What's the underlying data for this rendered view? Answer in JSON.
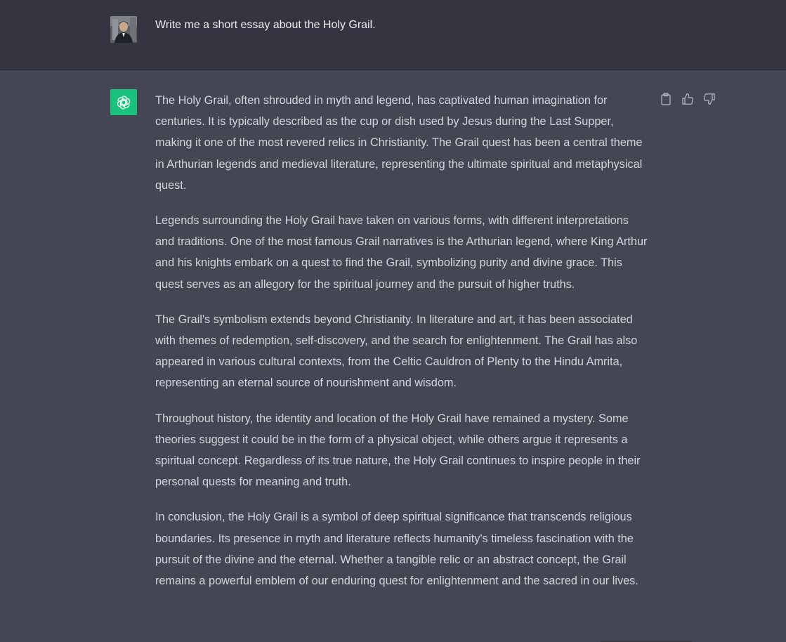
{
  "conversation": {
    "user_message": "Write me a short essay about the Holy Grail.",
    "assistant_paragraphs": [
      "The Holy Grail, often shrouded in myth and legend, has captivated human imagination for centuries. It is typically described as the cup or dish used by Jesus during the Last Supper, making it one of the most revered relics in Christianity. The Grail quest has been a central theme in Arthurian legends and medieval literature, representing the ultimate spiritual and metaphysical quest.",
      "Legends surrounding the Holy Grail have taken on various forms, with different interpretations and traditions. One of the most famous Grail narratives is the Arthurian legend, where King Arthur and his knights embark on a quest to find the Grail, symbolizing purity and divine grace. This quest serves as an allegory for the spiritual journey and the pursuit of higher truths.",
      "The Grail's symbolism extends beyond Christianity. In literature and art, it has been associated with themes of redemption, self-discovery, and the search for enlightenment. The Grail has also appeared in various cultural contexts, from the Celtic Cauldron of Plenty to the Hindu Amrita, representing an eternal source of nourishment and wisdom.",
      "Throughout history, the identity and location of the Holy Grail have remained a mystery. Some theories suggest it could be in the form of a physical object, while others argue it represents a spiritual concept. Regardless of its true nature, the Holy Grail continues to inspire people in their personal quests for meaning and truth.",
      "In conclusion, the Holy Grail is a symbol of deep spiritual significance that transcends religious boundaries. Its presence in myth and literature reflects humanity's timeless fascination with the pursuit of the divine and the eternal. Whether a tangible relic or an abstract concept, the Grail remains a powerful emblem of our enduring quest for enlightenment and the sacred in our lives."
    ]
  },
  "icons": {
    "user_avatar": "user-photo-avatar",
    "assistant_avatar": "openai-logo-icon",
    "actions": [
      "clipboard-icon",
      "thumbs-up-icon",
      "thumbs-down-icon"
    ]
  },
  "colors": {
    "user_row_bg": "#343541",
    "assistant_row_bg": "#444654",
    "assistant_avatar_bg": "#19c37d",
    "text": "#d1d5db",
    "icon": "#acacbe"
  }
}
